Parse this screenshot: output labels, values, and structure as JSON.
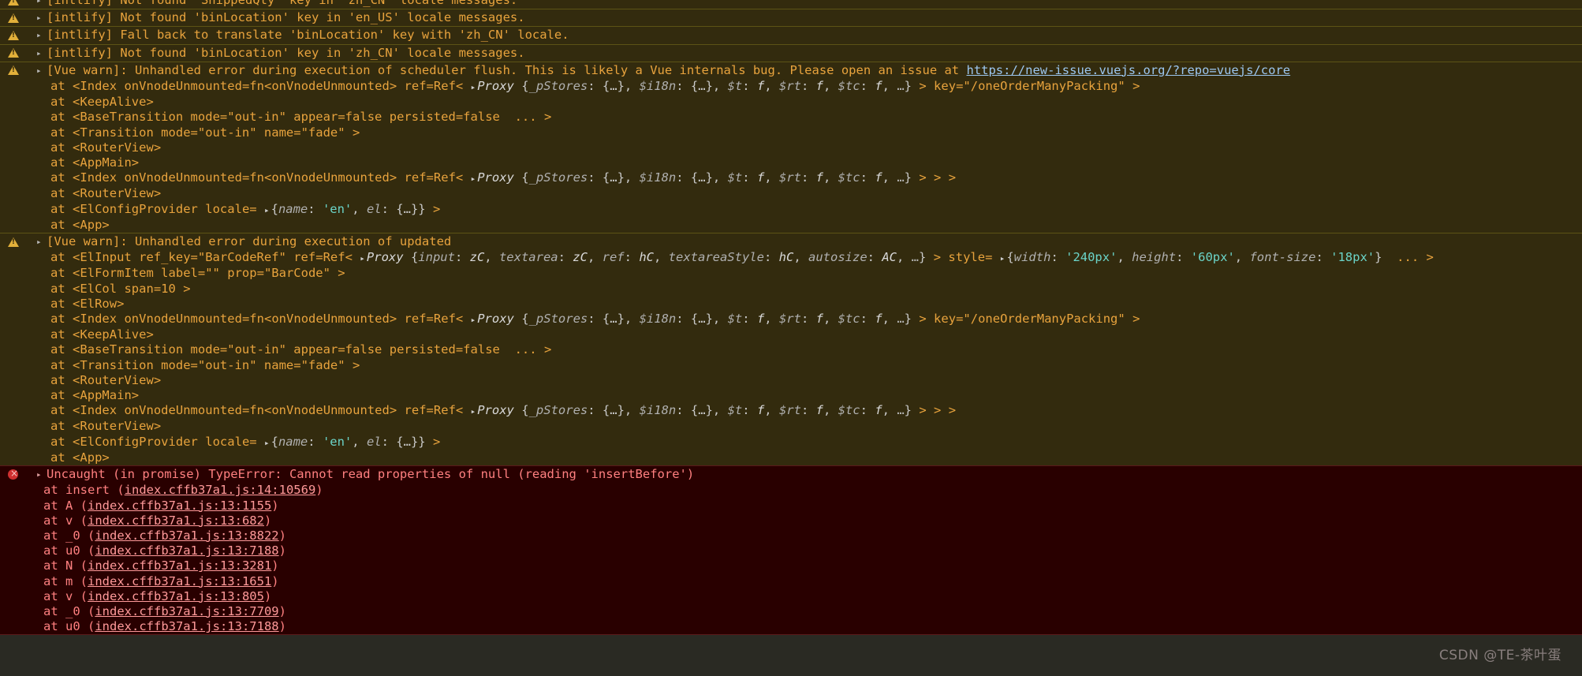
{
  "console": {
    "app": "Chrome DevTools Console",
    "colors": {
      "warn_background": "#332b0e",
      "warn_border": "#5c5315",
      "warn_text": "#e8a33d",
      "error_background": "#290000",
      "error_border": "#5a1a1a",
      "error_text": "#ff8080",
      "link": "#9cc7f0",
      "string": "#6bd4c8",
      "page_background": "#2a2a23"
    },
    "icons": {
      "warning": "warning-triangle-icon",
      "error": "error-circle-icon",
      "expand": "disclosure-triangle-icon"
    },
    "messages": [
      {
        "id": "m0",
        "level": "warning",
        "clipped": true,
        "text": "[intlify] Not found 'ShippedQty' key in 'zh_CN' locale messages."
      },
      {
        "id": "m1",
        "level": "warning",
        "text": "[intlify] Not found 'binLocation' key in 'en_US' locale messages."
      },
      {
        "id": "m2",
        "level": "warning",
        "text": "[intlify] Fall back to translate 'binLocation' key with 'zh_CN' locale."
      },
      {
        "id": "m3",
        "level": "warning",
        "text": "[intlify] Not found 'binLocation' key in 'zh_CN' locale messages."
      },
      {
        "id": "m4",
        "level": "warning",
        "head": "[Vue warn]: Unhandled error during execution of scheduler flush. This is likely a Vue internals bug. Please open an issue at ",
        "head_link": "https://new-issue.vuejs.org/?repo=vuejs/core",
        "frames": [
          "at <Index onVnodeUnmounted=fn<onVnodeUnmounted> ref=Ref< ▸Proxy {_pStores: {…}, $i18n: {…}, $t: f, $rt: f, $tc: f, …} > key=\"/oneOrderManyPacking\" >",
          "at <KeepAlive>",
          "at <BaseTransition mode=\"out-in\" appear=false persisted=false  ... >",
          "at <Transition mode=\"out-in\" name=\"fade\" >",
          "at <RouterView>",
          "at <AppMain>",
          "at <Index onVnodeUnmounted=fn<onVnodeUnmounted> ref=Ref< ▸Proxy {_pStores: {…}, $i18n: {…}, $t: f, $rt: f, $tc: f, …} > > >",
          "at <RouterView>",
          "at <ElConfigProvider locale= ▸{name: 'en', el: {…}} >",
          "at <App>"
        ]
      },
      {
        "id": "m5",
        "level": "warning",
        "head": "[Vue warn]: Unhandled error during execution of updated",
        "head_link": "",
        "frames": [
          "at <ElInput ref_key=\"BarCodeRef\" ref=Ref< ▸Proxy {input: zC, textarea: zC, ref: hC, textareaStyle: hC, autosize: AC, …} > style= ▸{width: '240px', height: '60px', font-size: '18px'}  ... >",
          "at <ElFormItem label=\"\" prop=\"BarCode\" >",
          "at <ElCol span=10 >",
          "at <ElRow>",
          "at <Index onVnodeUnmounted=fn<onVnodeUnmounted> ref=Ref< ▸Proxy {_pStores: {…}, $i18n: {…}, $t: f, $rt: f, $tc: f, …} > key=\"/oneOrderManyPacking\" >",
          "at <KeepAlive>",
          "at <BaseTransition mode=\"out-in\" appear=false persisted=false  ... >",
          "at <Transition mode=\"out-in\" name=\"fade\" >",
          "at <RouterView>",
          "at <AppMain>",
          "at <Index onVnodeUnmounted=fn<onVnodeUnmounted> ref=Ref< ▸Proxy {_pStores: {…}, $i18n: {…}, $t: f, $rt: f, $tc: f, …} > > >",
          "at <RouterView>",
          "at <ElConfigProvider locale= ▸{name: 'en', el: {…}} >",
          "at <App>"
        ]
      },
      {
        "id": "m6",
        "level": "error",
        "head": "Uncaught (in promise) TypeError: Cannot read properties of null (reading 'insertBefore')",
        "frames": [
          {
            "fn": "at insert (",
            "link": "index.cffb37a1.js:14:10569",
            "tail": ")"
          },
          {
            "fn": "at A (",
            "link": "index.cffb37a1.js:13:1155",
            "tail": ")"
          },
          {
            "fn": "at v (",
            "link": "index.cffb37a1.js:13:682",
            "tail": ")"
          },
          {
            "fn": "at _0 (",
            "link": "index.cffb37a1.js:13:8822",
            "tail": ")"
          },
          {
            "fn": "at u0 (",
            "link": "index.cffb37a1.js:13:7188",
            "tail": ")"
          },
          {
            "fn": "at N (",
            "link": "index.cffb37a1.js:13:3281",
            "tail": ")"
          },
          {
            "fn": "at m (",
            "link": "index.cffb37a1.js:13:1651",
            "tail": ")"
          },
          {
            "fn": "at v (",
            "link": "index.cffb37a1.js:13:805",
            "tail": ")"
          },
          {
            "fn": "at _0 (",
            "link": "index.cffb37a1.js:13:7709",
            "tail": ")"
          },
          {
            "fn": "at u0 (",
            "link": "index.cffb37a1.js:13:7188",
            "tail": ")"
          }
        ]
      }
    ],
    "watermark": "CSDN @TE-茶叶蛋"
  }
}
